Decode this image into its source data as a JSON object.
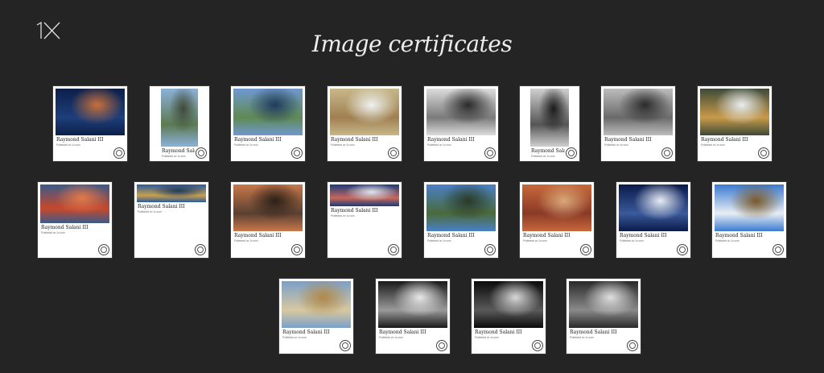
{
  "page": {
    "title": "Image certificates"
  },
  "brand": {
    "logo_icon": "1x-logo-icon"
  },
  "colors": {
    "background": "#242424",
    "card": "#ffffff",
    "title": "#ececec"
  },
  "certificates": [
    {
      "author": "Raymond Salani III",
      "subtitle": "Published on 1x.com",
      "scene": "night lake with bare trees",
      "palette": [
        "#0b1f4a",
        "#1e3f7a",
        "#c9703a"
      ]
    },
    {
      "author": "Raymond Salani III",
      "subtitle": "Published on 1x.com",
      "scene": "mountain creek",
      "palette": [
        "#8bb2d9",
        "#5d7a52",
        "#3f4a3a"
      ]
    },
    {
      "author": "Raymond Salani III",
      "subtitle": "Published on 1x.com",
      "scene": "mountain reflection lake",
      "palette": [
        "#6f98d0",
        "#5f8a52",
        "#1f3b5a"
      ]
    },
    {
      "author": "Raymond Salani III",
      "subtitle": "Published on 1x.com",
      "scene": "canyon waterfall",
      "palette": [
        "#c8b78a",
        "#a08050",
        "#eef2f0"
      ]
    },
    {
      "author": "Raymond Salani III",
      "subtitle": "Published on 1x.com",
      "scene": "black and white valley",
      "palette": [
        "#dcdcdc",
        "#7a7a7a",
        "#2a2a2a"
      ]
    },
    {
      "author": "Raymond Salani III",
      "subtitle": "Published on 1x.com",
      "scene": "black and white waterfall",
      "palette": [
        "#cfcfcf",
        "#555555",
        "#1a1a1a"
      ]
    },
    {
      "author": "Raymond Salani III",
      "subtitle": "Published on 1x.com",
      "scene": "black and white ridge",
      "palette": [
        "#bdbdbd",
        "#6a6a6a",
        "#2b2b2b"
      ]
    },
    {
      "author": "Raymond Salani III",
      "subtitle": "Published on 1x.com",
      "scene": "autumn waterfall",
      "palette": [
        "#3d4a38",
        "#c89a4a",
        "#e8eef0"
      ]
    },
    {
      "author": "Raymond Salani III",
      "subtitle": "Published on 1x.com",
      "scene": "red canyon sunset",
      "palette": [
        "#3a5a8a",
        "#c8482a",
        "#e27a4a"
      ]
    },
    {
      "author": "Raymond Salani III",
      "subtitle": "Published on 1x.com",
      "scene": "mountain lake panorama",
      "palette": [
        "#2a5aa0",
        "#c8a04a",
        "#1f3a5a"
      ]
    },
    {
      "author": "Raymond Salani III",
      "subtitle": "Published on 1x.com",
      "scene": "valley sunset",
      "palette": [
        "#c8784a",
        "#5a4032",
        "#2a2018"
      ]
    },
    {
      "author": "Raymond Salani III",
      "subtitle": "Published on 1x.com",
      "scene": "red mountain panorama",
      "palette": [
        "#1a3a7a",
        "#c8685a",
        "#dfe4ee"
      ]
    },
    {
      "author": "Raymond Salani III",
      "subtitle": "Published on 1x.com",
      "scene": "green mountain ridge",
      "palette": [
        "#4a80c8",
        "#4a6a3a",
        "#2a3a28"
      ]
    },
    {
      "author": "Raymond Salani III",
      "subtitle": "Published on 1x.com",
      "scene": "red canyon",
      "palette": [
        "#c8683a",
        "#8a3a28",
        "#d8a878"
      ]
    },
    {
      "author": "Raymond Salani III",
      "subtitle": "Published on 1x.com",
      "scene": "moonlit snowy peaks",
      "palette": [
        "#0a1a4a",
        "#3a5a9a",
        "#e8ecf4"
      ]
    },
    {
      "author": "Raymond Salani III",
      "subtitle": "Published on 1x.com",
      "scene": "alpine meadow",
      "palette": [
        "#3a7ad0",
        "#e8eef4",
        "#7a5a2a"
      ]
    },
    {
      "author": "Raymond Salani III",
      "subtitle": "Published on 1x.com",
      "scene": "moon over grass",
      "palette": [
        "#7aa0c8",
        "#d8c8a0",
        "#b08848"
      ]
    },
    {
      "author": "Raymond Salani III",
      "subtitle": "Published on 1x.com",
      "scene": "black and white waterfall mist",
      "palette": [
        "#1a1a1a",
        "#9a9a9a",
        "#e8e8e8"
      ]
    },
    {
      "author": "Raymond Salani III",
      "subtitle": "Published on 1x.com",
      "scene": "black and white night peaks",
      "palette": [
        "#0a0a0a",
        "#5a5a5a",
        "#d8d8d8"
      ]
    },
    {
      "author": "Raymond Salani III",
      "subtitle": "Published on 1x.com",
      "scene": "black and white valley view",
      "palette": [
        "#2a2a2a",
        "#8a8a8a",
        "#e0e0e0"
      ]
    }
  ]
}
